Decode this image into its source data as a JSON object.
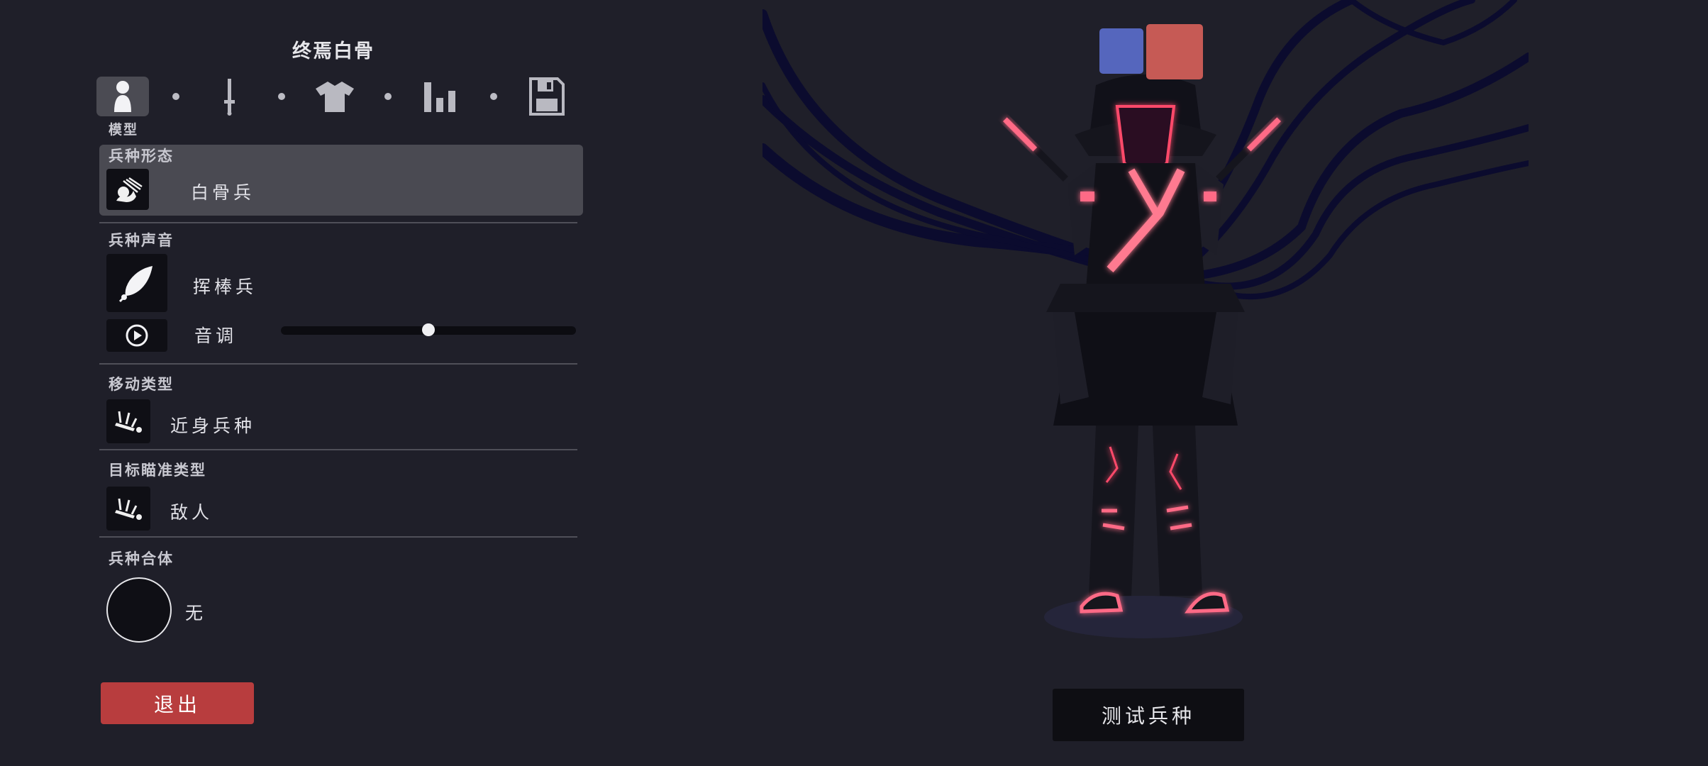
{
  "unit_name": "终焉白骨",
  "tabs": [
    {
      "id": "model",
      "icon": "person-icon",
      "active": true
    },
    {
      "id": "weapon",
      "icon": "sword-icon",
      "active": false
    },
    {
      "id": "clothing",
      "icon": "shirt-icon",
      "active": false
    },
    {
      "id": "stats",
      "icon": "bar-chart-icon",
      "active": false
    },
    {
      "id": "save",
      "icon": "save-icon",
      "active": false
    }
  ],
  "active_tab_label": "模型",
  "unit_form": {
    "label": "兵种形态",
    "value": "白骨兵",
    "icon": "skeleton-unit-icon"
  },
  "unit_voice": {
    "label": "兵种声音",
    "value": "挥棒兵",
    "icon": "feather-icon",
    "play_icon": "play-icon",
    "pitch_label": "音调",
    "pitch_value": 0.5
  },
  "movement_type": {
    "label": "移动类型",
    "value": "近身兵种",
    "icon": "fallen-unit-icon"
  },
  "target_type": {
    "label": "目标瞄准类型",
    "value": "敌人",
    "icon": "fallen-unit-icon"
  },
  "unit_merge": {
    "label": "兵种合体",
    "value": "无"
  },
  "exit_button": "退出",
  "test_button": "测试兵种",
  "colors": {
    "background": "#1f1f29",
    "highlight": "#4a4a52",
    "exit": "#b83d3e",
    "team_blue": "#5566bd",
    "team_red": "#c65a55",
    "glow": "#ff4a6a"
  }
}
